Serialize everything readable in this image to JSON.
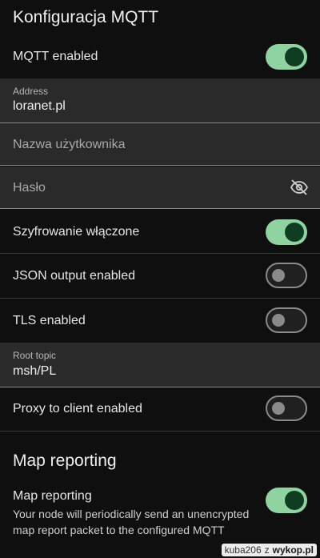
{
  "mqtt": {
    "section_title": "Konfiguracja MQTT",
    "enabled_label": "MQTT enabled",
    "enabled": true,
    "address": {
      "label": "Address",
      "value": "loranet.pl"
    },
    "username": {
      "placeholder": "Nazwa użytkownika"
    },
    "password": {
      "placeholder": "Hasło",
      "icon": "eye-off-icon"
    },
    "encryption_label": "Szyfrowanie włączone",
    "encryption_enabled": true,
    "json_label": "JSON output enabled",
    "json_enabled": false,
    "tls_label": "TLS enabled",
    "tls_enabled": false,
    "root_topic": {
      "label": "Root topic",
      "value": "msh/PL"
    },
    "proxy_label": "Proxy to client enabled",
    "proxy_enabled": false
  },
  "map_reporting": {
    "section_title": "Map reporting",
    "toggle_label": "Map reporting",
    "enabled": true,
    "description": "Your node will periodically send an unencrypted map report packet to the configured MQTT"
  },
  "watermark": {
    "user": "kuba206",
    "separator": "z",
    "site": "wykop.pl"
  },
  "colors": {
    "accent_on": "#8ed3a0",
    "thumb_on": "#0f3d22",
    "off_outline": "#8a8a8a",
    "background": "#0f0f0f",
    "field_bg": "#2a2a2a"
  }
}
